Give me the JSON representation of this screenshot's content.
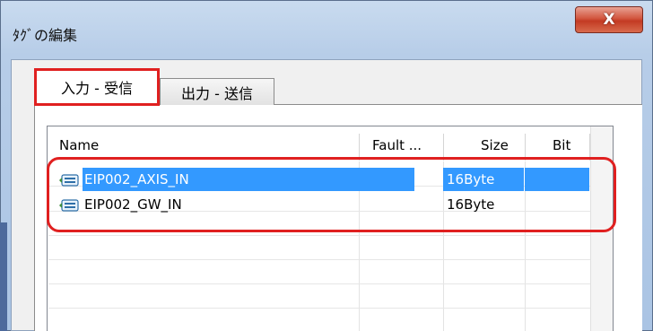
{
  "window": {
    "title": "ﾀｸﾞの編集",
    "close_label": "X"
  },
  "tabs": [
    {
      "label": "入力 - 受信",
      "active": true
    },
    {
      "label": "出力 - 送信",
      "active": false
    }
  ],
  "table": {
    "columns": [
      "Name",
      "Fault ...",
      "Size",
      "Bit"
    ],
    "rows": [
      {
        "icon": "tag-icon",
        "name": "EIP002_AXIS_IN",
        "fault": "",
        "size": "16Byte",
        "bit": "",
        "selected": true
      },
      {
        "icon": "tag-icon",
        "name": "EIP002_GW_IN",
        "fault": "",
        "size": "16Byte",
        "bit": "",
        "selected": false
      }
    ]
  },
  "colors": {
    "selection": "#3399ff",
    "annotation": "#e02020",
    "close_button": "#c33a23"
  }
}
